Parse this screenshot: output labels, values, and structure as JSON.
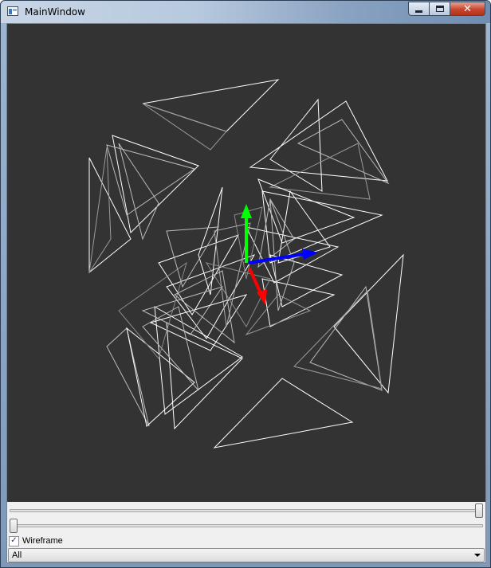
{
  "window": {
    "title": "MainWindow",
    "controls": {
      "minimize": "minimize",
      "maximize": "maximize",
      "close": "✕"
    }
  },
  "viewport": {
    "background": "#333333",
    "wire_color": "#ffffff",
    "axes": {
      "x_color": "#ff0000",
      "y_color": "#00ff00",
      "z_color": "#0000ff"
    }
  },
  "controls": {
    "slider_1_value": 1.0,
    "slider_2_value": 0.0,
    "wireframe_checked": true,
    "wireframe_label": "Wireframe",
    "check_glyph": "✓",
    "mode_selected": "All"
  }
}
